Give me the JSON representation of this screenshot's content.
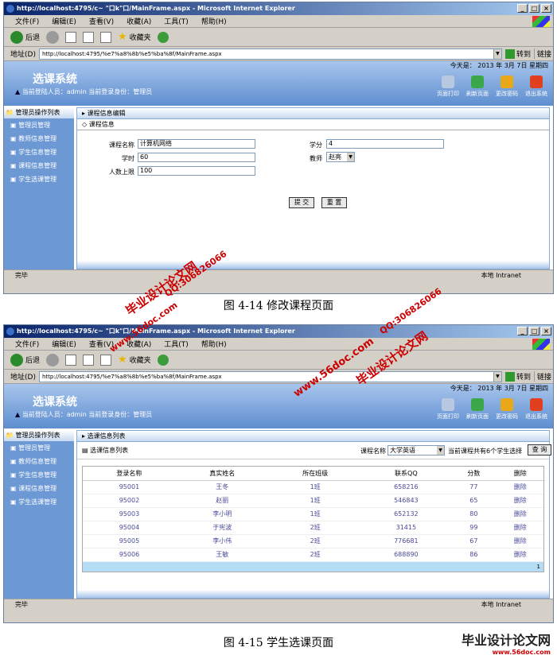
{
  "window": {
    "title": "http://localhost:4795/c~ \"口k\"口/MainFrame.aspx - Microsoft Internet Explorer",
    "title2": "http://localhost:4795/c~ \"口k\"口/MainFrame.aspx - Microsoft Internet Explorer"
  },
  "menu": [
    "文件(F)",
    "编辑(E)",
    "查看(V)",
    "收藏(A)",
    "工具(T)",
    "帮助(H)"
  ],
  "toolbar": {
    "back": "后退",
    "favorites": "收藏夹"
  },
  "address": {
    "label": "地址(D)",
    "url": "http://localhost:4795/%e7%a8%8b%e5%ba%8f/MainFrame.aspx",
    "go": "转到",
    "links": "链接"
  },
  "app": {
    "date": "今天是： 2013 年  3月  7日  星期四",
    "title": "选课系统",
    "user": "当前登陆人员：admin 当前登录身份：管理员",
    "buttons": [
      "页面打印",
      "刷新页面",
      "更改密码",
      "退出系统"
    ],
    "sidebar": {
      "header": "管理员操作列表",
      "items": [
        "管理员管理",
        "教师信息管理",
        "学生信息管理",
        "课程信息管理",
        "学生选课管理"
      ]
    }
  },
  "edit": {
    "crumb": "课程信息编辑",
    "section": "课程信息",
    "labels": {
      "name": "课程名称",
      "credit": "学分",
      "hours": "学时",
      "teacher": "教师",
      "limit": "人数上限"
    },
    "values": {
      "name": "计算机网络",
      "credit": "4",
      "hours": "60",
      "teacher": "赵亮",
      "limit": "100"
    },
    "submit": "提 交",
    "reset": "重 置"
  },
  "status": {
    "done": "完毕",
    "zone": "本地 Intranet"
  },
  "caption1": "图 4-14  修改课程页面",
  "list": {
    "crumb": "选课信息列表",
    "title": "选课信息列表",
    "course_label": "课程名称",
    "course": "大学英语",
    "count": "当前课程共有6个学生选择",
    "query": "查 询",
    "headers": [
      "登录名称",
      "真实姓名",
      "所在班级",
      "联系QQ",
      "分数",
      "删除"
    ],
    "rows": [
      [
        "95001",
        "王冬",
        "1班",
        "658216",
        "77",
        "删除"
      ],
      [
        "95002",
        "赵丽",
        "1班",
        "546843",
        "65",
        "删除"
      ],
      [
        "95003",
        "李小明",
        "1班",
        "652132",
        "80",
        "删除"
      ],
      [
        "95004",
        "于宪波",
        "2班",
        "31415",
        "99",
        "删除"
      ],
      [
        "95005",
        "李小伟",
        "2班",
        "776681",
        "67",
        "删除"
      ],
      [
        "95006",
        "王敏",
        "2班",
        "688890",
        "86",
        "删除"
      ]
    ],
    "page": "1"
  },
  "caption2": "图 4-15 学生选课页面",
  "watermarks": [
    "毕业设计论文网",
    "QQ:306826066",
    "www.56doc.com"
  ],
  "logo": {
    "name": "毕业设计论文网",
    "url": "www.56doc.com"
  }
}
